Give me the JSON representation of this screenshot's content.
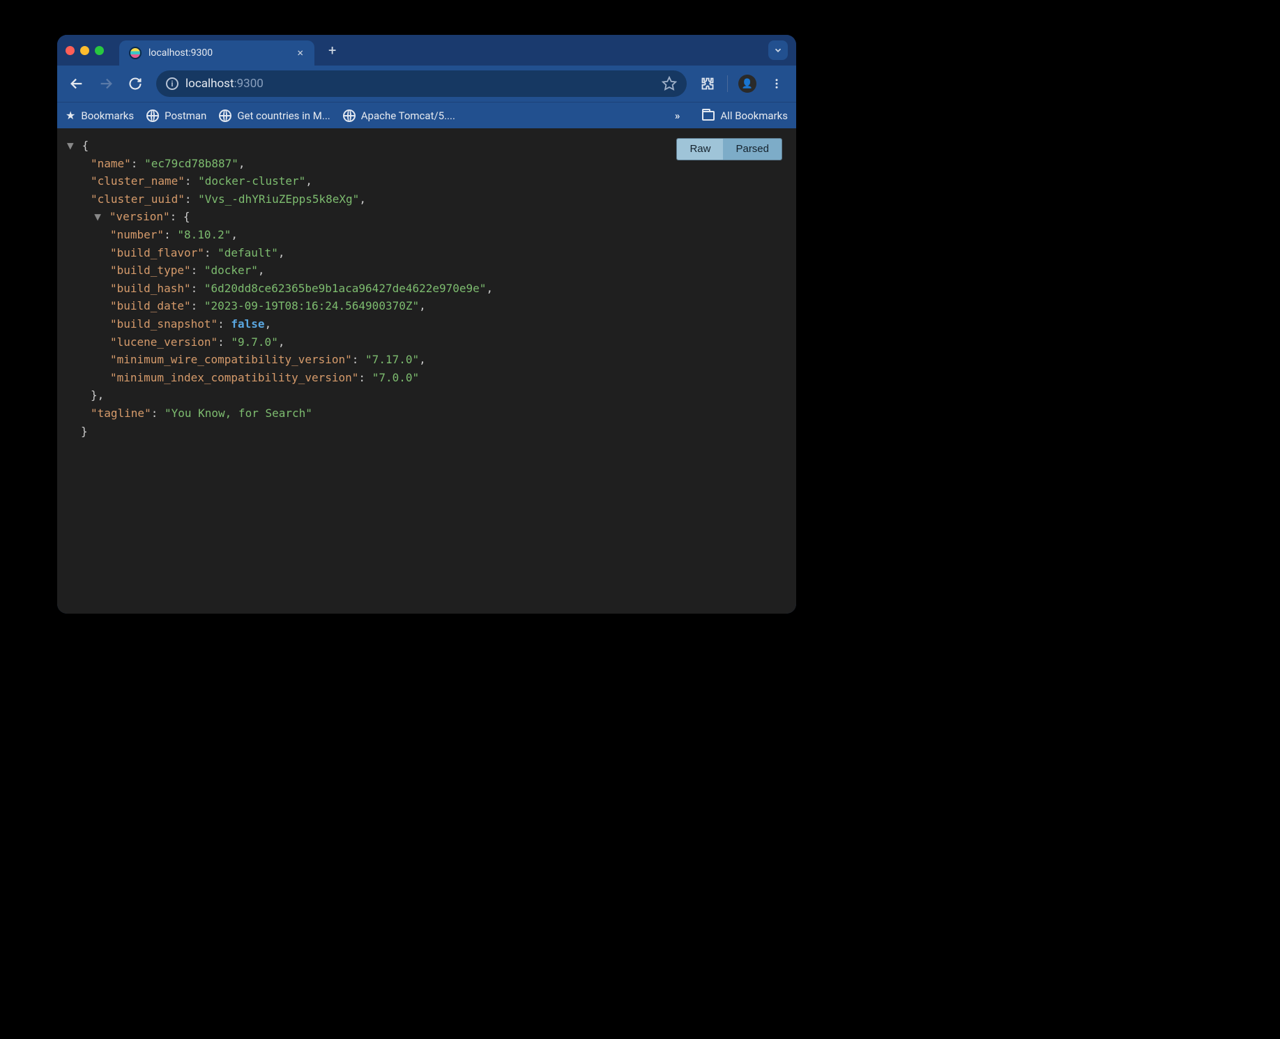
{
  "tab": {
    "title": "localhost:9300"
  },
  "url": {
    "host": "localhost",
    "rest": ":9300"
  },
  "bookmarks_bar": {
    "bookmarks_label": "Bookmarks",
    "items": [
      "Postman",
      "Get countries in M...",
      "Apache Tomcat/5...."
    ],
    "overflow": "»",
    "all_bookmarks": "All Bookmarks"
  },
  "view_toggle": {
    "raw": "Raw",
    "parsed": "Parsed"
  },
  "json": {
    "k_name": "\"name\"",
    "v_name": "\"ec79cd78b887\"",
    "k_cluster_name": "\"cluster_name\"",
    "v_cluster_name": "\"docker-cluster\"",
    "k_cluster_uuid": "\"cluster_uuid\"",
    "v_cluster_uuid": "\"Vvs_-dhYRiuZEpps5k8eXg\"",
    "k_version": "\"version\"",
    "k_number": "\"number\"",
    "v_number": "\"8.10.2\"",
    "k_build_flavor": "\"build_flavor\"",
    "v_build_flavor": "\"default\"",
    "k_build_type": "\"build_type\"",
    "v_build_type": "\"docker\"",
    "k_build_hash": "\"build_hash\"",
    "v_build_hash": "\"6d20dd8ce62365be9b1aca96427de4622e970e9e\"",
    "k_build_date": "\"build_date\"",
    "v_build_date": "\"2023-09-19T08:16:24.564900370Z\"",
    "k_build_snapshot": "\"build_snapshot\"",
    "v_build_snapshot": "false",
    "k_lucene_version": "\"lucene_version\"",
    "v_lucene_version": "\"9.7.0\"",
    "k_min_wire": "\"minimum_wire_compatibility_version\"",
    "v_min_wire": "\"7.17.0\"",
    "k_min_index": "\"minimum_index_compatibility_version\"",
    "v_min_index": "\"7.0.0\"",
    "k_tagline": "\"tagline\"",
    "v_tagline": "\"You Know, for Search\""
  }
}
